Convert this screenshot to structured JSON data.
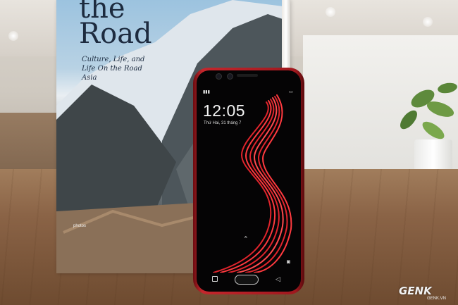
{
  "book": {
    "title": "the\nRoad",
    "subtitle": "Culture, Life, and Life On the Road Asia",
    "credit": "photos"
  },
  "phone": {
    "time": "12:05",
    "date": "Thứ Hai, 31 tháng 7",
    "swipe_icon": "chevron-up-icon",
    "camera_icon": "camera-icon",
    "accent_color": "#e0242c"
  },
  "watermark": {
    "brand": "GENK",
    "domain": "GENK.VN"
  }
}
